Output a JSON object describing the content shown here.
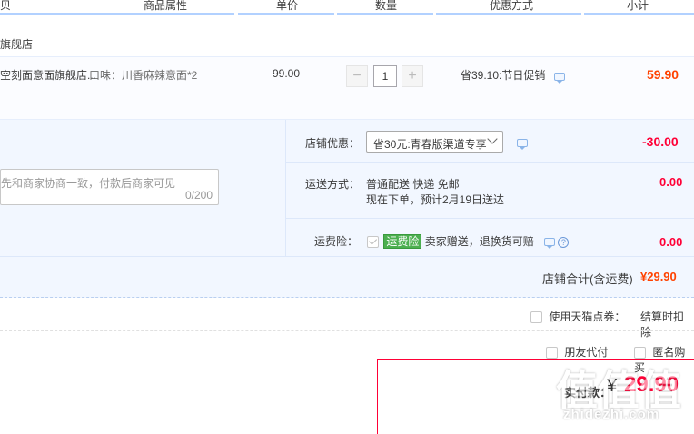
{
  "header": {
    "col_product": "贝",
    "col_attr": "商品属性",
    "col_price": "单价",
    "col_qty": "数量",
    "col_discount": "优惠方式",
    "col_subtotal": "小计"
  },
  "shop": {
    "name": "旗舰店"
  },
  "item": {
    "title": "空刻面意面旗舰店...",
    "attr": "口味：川香麻辣意面*2",
    "price": "99.00",
    "qty_minus": "−",
    "qty_value": "1",
    "qty_plus": "+",
    "promo": "省39.10:节日促销",
    "subtotal": "59.90"
  },
  "message": {
    "placeholder": "先和商家协商一致，付款后商家可见",
    "count": "0/200"
  },
  "store_coupon": {
    "label": "店铺优惠：",
    "selected": "省30元:青春版渠道专享",
    "amount": "-30.00"
  },
  "shipping": {
    "label": "运送方式：",
    "method": "普通配送 快递 免邮",
    "eta": "现在下单，预计2月19日送达",
    "amount": "0.00"
  },
  "insurance": {
    "label": "运费险：",
    "badge": "运费险",
    "text": "卖家赠送，退换货可赔",
    "help": "?",
    "amount": "0.00"
  },
  "store_total": {
    "label": "店铺合计(含运费)",
    "amount": "¥29.90"
  },
  "tmall_points": {
    "label": "使用天猫点券：",
    "note": "结算时扣除"
  },
  "friend_pay": {
    "label": "朋友代付"
  },
  "anonymous": {
    "label": "匿名购买"
  },
  "payment": {
    "label": "实付款：",
    "yen": "¥",
    "amount": "29.90"
  },
  "watermark": {
    "glyphs": "值值值",
    "site": "zhidezhi.com"
  }
}
